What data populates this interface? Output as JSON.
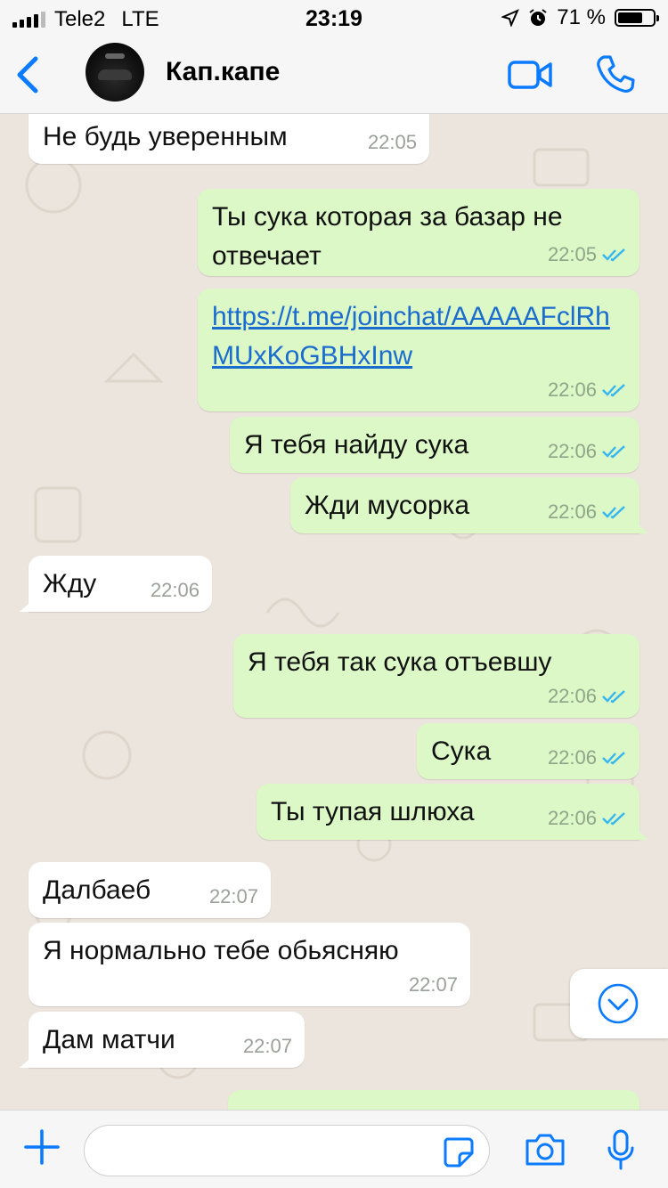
{
  "status_bar": {
    "carrier": "Tele2",
    "network": "LTE",
    "time": "23:19",
    "battery": "71 %",
    "battery_level": 0.71
  },
  "header": {
    "title": "Кап.капе",
    "back_icon": "chevron-left-icon",
    "video_icon": "video-call-icon",
    "phone_icon": "phone-icon"
  },
  "messages": [
    {
      "dir": "in",
      "text": "Не будь уверенным",
      "time": "22:05"
    },
    {
      "dir": "out",
      "text": "Ты сука которая за базар не отвечает",
      "time": "22:05"
    },
    {
      "dir": "out",
      "text": "https://t.me/joinchat/AAAAAFclRhMUxKoGBHxInw",
      "time": "22:06"
    },
    {
      "dir": "out",
      "text": "Я тебя найду сука",
      "time": "22:06"
    },
    {
      "dir": "out",
      "text": "Жди мусорка",
      "time": "22:06"
    },
    {
      "dir": "in",
      "text": "Жду",
      "time": "22:06"
    },
    {
      "dir": "out",
      "text": "Я тебя так сука отъевшу",
      "time": "22:06"
    },
    {
      "dir": "out",
      "text": "Сука",
      "time": "22:06"
    },
    {
      "dir": "out",
      "text": "Ты тупая шлюха",
      "time": "22:06"
    },
    {
      "dir": "in",
      "text": "Далбаеб",
      "time": "22:07"
    },
    {
      "dir": "in",
      "text": "Я нормально тебе обьясняю",
      "time": "22:07"
    },
    {
      "dir": "in",
      "text": "Дам матчи",
      "time": "22:07"
    }
  ],
  "composer": {
    "placeholder": ""
  },
  "colors": {
    "accent": "#0a7aff",
    "outgoing": "#dcf8c6",
    "incoming": "#ffffff",
    "read_ticks": "#34b7f1"
  }
}
